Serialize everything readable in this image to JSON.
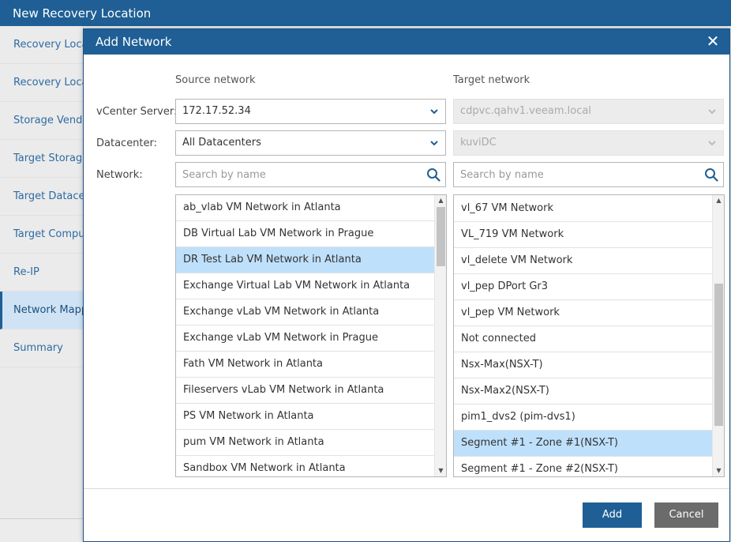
{
  "background": {
    "window_title": "New Recovery Location",
    "nav_items": [
      {
        "label": "Recovery Location",
        "active": false
      },
      {
        "label": "Recovery Location",
        "active": false
      },
      {
        "label": "Storage Vendor",
        "active": false
      },
      {
        "label": "Target Storage",
        "active": false
      },
      {
        "label": "Target Datacenter",
        "active": false
      },
      {
        "label": "Target Compute",
        "active": false
      },
      {
        "label": "Re-IP",
        "active": false
      },
      {
        "label": "Network Mapping",
        "active": true
      },
      {
        "label": "Summary",
        "active": false
      }
    ]
  },
  "dialog": {
    "title": "Add Network",
    "close_glyph": "✕",
    "source_header": "Source network",
    "target_header": "Target network",
    "labels": {
      "vcenter": "vCenter Server:",
      "datacenter": "Datacenter:",
      "network": "Network:"
    },
    "source": {
      "vcenter_value": "172.17.52.34",
      "datacenter_value": "All Datacenters",
      "search_placeholder": "Search by name",
      "networks": [
        {
          "name": "ab_vlab VM Network in Atlanta",
          "selected": false
        },
        {
          "name": "DB Virtual Lab VM Network in Prague",
          "selected": false
        },
        {
          "name": "DR Test Lab VM Network in Atlanta",
          "selected": true
        },
        {
          "name": "Exchange Virtual Lab VM Network in Atlanta",
          "selected": false
        },
        {
          "name": "Exchange vLab VM Network in Atlanta",
          "selected": false
        },
        {
          "name": "Exchange vLab VM Network in Prague",
          "selected": false
        },
        {
          "name": "Fath VM Network in Atlanta",
          "selected": false
        },
        {
          "name": "Fileservers vLab VM Network in Atlanta",
          "selected": false
        },
        {
          "name": "PS VM Network in Atlanta",
          "selected": false
        },
        {
          "name": "pum VM Network in Atlanta",
          "selected": false
        },
        {
          "name": "Sandbox VM Network in Atlanta",
          "selected": false
        }
      ]
    },
    "target": {
      "vcenter_value": "cdpvc.qahv1.veeam.local",
      "datacenter_value": "kuviDC",
      "search_placeholder": "Search by name",
      "networks": [
        {
          "name": "vl_67 VM Network",
          "selected": false
        },
        {
          "name": "VL_719 VM Network",
          "selected": false
        },
        {
          "name": "vl_delete VM Network",
          "selected": false
        },
        {
          "name": "vl_pep DPort Gr3",
          "selected": false
        },
        {
          "name": "vl_pep VM Network",
          "selected": false
        },
        {
          "name": "Not connected",
          "selected": false
        },
        {
          "name": "Nsx-Max(NSX-T)",
          "selected": false
        },
        {
          "name": "Nsx-Max2(NSX-T)",
          "selected": false
        },
        {
          "name": "pim1_dvs2 (pim-dvs1)",
          "selected": false
        },
        {
          "name": "Segment #1 - Zone #1(NSX-T)",
          "selected": true
        },
        {
          "name": "Segment #1 - Zone #2(NSX-T)",
          "selected": false
        }
      ]
    },
    "buttons": {
      "add": "Add",
      "cancel": "Cancel"
    }
  },
  "colors": {
    "header_blue": "#1f5f95",
    "selected_row": "#bfe0fb",
    "cancel_gray": "#6b6b6b"
  }
}
